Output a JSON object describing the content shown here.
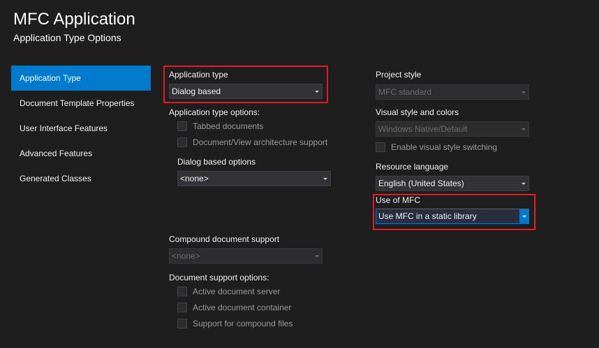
{
  "header": {
    "title": "MFC Application",
    "subtitle": "Application Type Options"
  },
  "nav": {
    "items": [
      {
        "label": "Application Type",
        "active": true
      },
      {
        "label": "Document Template Properties"
      },
      {
        "label": "User Interface Features"
      },
      {
        "label": "Advanced Features"
      },
      {
        "label": "Generated Classes"
      }
    ]
  },
  "left": {
    "app_type_label": "Application type",
    "app_type_value": "Dialog based",
    "app_type_options_label": "Application type options:",
    "tabbed_documents": "Tabbed documents",
    "doc_view_support": "Document/View architecture support",
    "dialog_options_label": "Dialog based options",
    "dialog_options_value": "<none>",
    "compound_label": "Compound document support",
    "compound_value": "<none>",
    "doc_support_options_label": "Document support options:",
    "active_doc_server": "Active document server",
    "active_doc_container": "Active document container",
    "compound_files_support": "Support for compound files"
  },
  "right": {
    "project_style_label": "Project style",
    "project_style_value": "MFC standard",
    "visual_style_label": "Visual style and colors",
    "visual_style_value": "Windows Native/Default",
    "enable_visual_switching": "Enable visual style switching",
    "resource_lang_label": "Resource language",
    "resource_lang_value": "English (United States)",
    "use_mfc_label": "Use of MFC",
    "use_mfc_value": "Use MFC in a static library"
  },
  "colors": {
    "background": "#1e1e1e",
    "accent": "#007acc",
    "highlight_box": "#e51a23"
  }
}
